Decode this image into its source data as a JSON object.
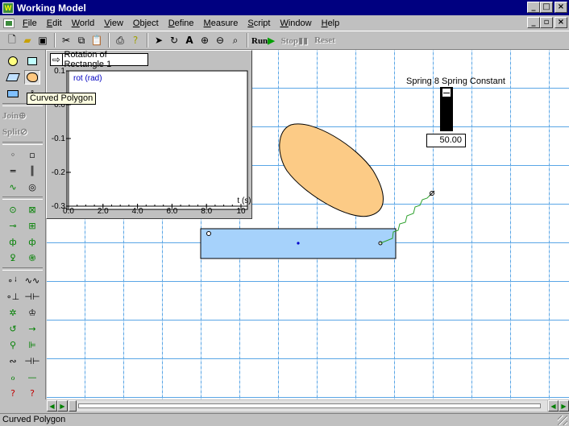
{
  "window": {
    "title": "Working Model",
    "controls": {
      "minimize": "_",
      "maximize": "□",
      "close": "×"
    }
  },
  "menu": {
    "items": [
      "File",
      "Edit",
      "World",
      "View",
      "Object",
      "Define",
      "Measure",
      "Script",
      "Window",
      "Help"
    ],
    "child_controls": {
      "minimize": "_",
      "restore": "▫",
      "close": "×"
    }
  },
  "toolbar": {
    "icons": [
      "new-document-icon",
      "open-folder-icon",
      "save-disk-icon",
      "cut-scissors-icon",
      "copy-icon",
      "paste-icon",
      "print-icon",
      "help-pointer-icon",
      "arrow-select-icon",
      "rotate-icon",
      "text-tool-icon",
      "zoom-in-icon",
      "zoom-out-icon",
      "zoom-fit-icon"
    ],
    "run_label": "Run",
    "stop_label": "Stop",
    "reset_label": "Reset"
  },
  "palette": {
    "join_label": "Join",
    "split_label": "Split"
  },
  "tooltip": {
    "text": "Curved Polygon"
  },
  "graph": {
    "title": "Rotation of Rectangle 1",
    "chart_data": {
      "type": "line",
      "title": "Rotation of Rectangle 1",
      "series": [
        {
          "name": "rot (rad)",
          "x": [],
          "y": []
        }
      ],
      "xlabel": "t (s)",
      "ylabel": "rot (rad)",
      "xlim": [
        0,
        10
      ],
      "ylim": [
        -0.3,
        0.1
      ],
      "x_ticks": [
        "0.0",
        "2.0",
        "4.0",
        "6.0",
        "8.0",
        "10"
      ],
      "y_ticks": [
        "0.1",
        "0.0",
        "-0.1",
        "-0.2",
        "-0.3"
      ],
      "grid": false
    }
  },
  "meter": {
    "label": "Spring 8 Spring Constant",
    "value": "50.00",
    "level_fraction": 1.0
  },
  "status": {
    "text": "Curved Polygon"
  },
  "colors": {
    "curved_polygon_fill": "#fccb86",
    "rectangle_fill": "#a6d2fb",
    "spring_color": "#2ca02c",
    "grid_color": "#5aa6e6",
    "title_bar": "#000080"
  }
}
